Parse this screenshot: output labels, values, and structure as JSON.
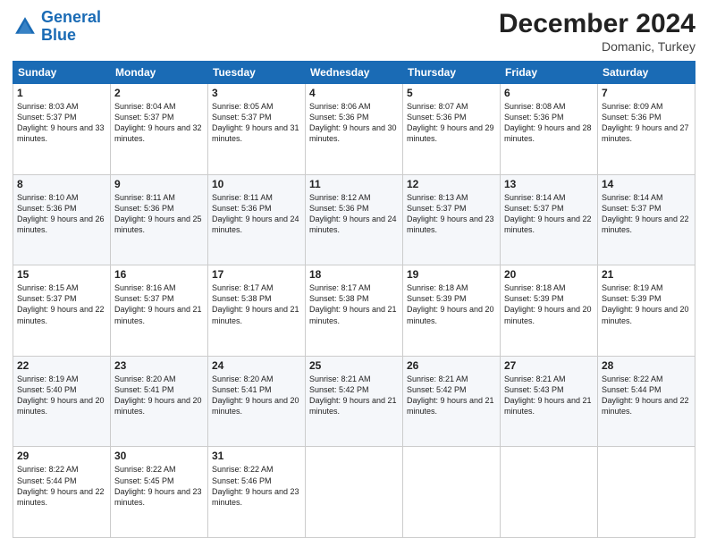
{
  "header": {
    "logo_line1": "General",
    "logo_line2": "Blue",
    "month_title": "December 2024",
    "location": "Domanic, Turkey"
  },
  "days_of_week": [
    "Sunday",
    "Monday",
    "Tuesday",
    "Wednesday",
    "Thursday",
    "Friday",
    "Saturday"
  ],
  "weeks": [
    [
      {
        "day": "1",
        "sunrise": "8:03 AM",
        "sunset": "5:37 PM",
        "daylight": "9 hours and 33 minutes."
      },
      {
        "day": "2",
        "sunrise": "8:04 AM",
        "sunset": "5:37 PM",
        "daylight": "9 hours and 32 minutes."
      },
      {
        "day": "3",
        "sunrise": "8:05 AM",
        "sunset": "5:37 PM",
        "daylight": "9 hours and 31 minutes."
      },
      {
        "day": "4",
        "sunrise": "8:06 AM",
        "sunset": "5:36 PM",
        "daylight": "9 hours and 30 minutes."
      },
      {
        "day": "5",
        "sunrise": "8:07 AM",
        "sunset": "5:36 PM",
        "daylight": "9 hours and 29 minutes."
      },
      {
        "day": "6",
        "sunrise": "8:08 AM",
        "sunset": "5:36 PM",
        "daylight": "9 hours and 28 minutes."
      },
      {
        "day": "7",
        "sunrise": "8:09 AM",
        "sunset": "5:36 PM",
        "daylight": "9 hours and 27 minutes."
      }
    ],
    [
      {
        "day": "8",
        "sunrise": "8:10 AM",
        "sunset": "5:36 PM",
        "daylight": "9 hours and 26 minutes."
      },
      {
        "day": "9",
        "sunrise": "8:11 AM",
        "sunset": "5:36 PM",
        "daylight": "9 hours and 25 minutes."
      },
      {
        "day": "10",
        "sunrise": "8:11 AM",
        "sunset": "5:36 PM",
        "daylight": "9 hours and 24 minutes."
      },
      {
        "day": "11",
        "sunrise": "8:12 AM",
        "sunset": "5:36 PM",
        "daylight": "9 hours and 24 minutes."
      },
      {
        "day": "12",
        "sunrise": "8:13 AM",
        "sunset": "5:37 PM",
        "daylight": "9 hours and 23 minutes."
      },
      {
        "day": "13",
        "sunrise": "8:14 AM",
        "sunset": "5:37 PM",
        "daylight": "9 hours and 22 minutes."
      },
      {
        "day": "14",
        "sunrise": "8:14 AM",
        "sunset": "5:37 PM",
        "daylight": "9 hours and 22 minutes."
      }
    ],
    [
      {
        "day": "15",
        "sunrise": "8:15 AM",
        "sunset": "5:37 PM",
        "daylight": "9 hours and 22 minutes."
      },
      {
        "day": "16",
        "sunrise": "8:16 AM",
        "sunset": "5:37 PM",
        "daylight": "9 hours and 21 minutes."
      },
      {
        "day": "17",
        "sunrise": "8:17 AM",
        "sunset": "5:38 PM",
        "daylight": "9 hours and 21 minutes."
      },
      {
        "day": "18",
        "sunrise": "8:17 AM",
        "sunset": "5:38 PM",
        "daylight": "9 hours and 21 minutes."
      },
      {
        "day": "19",
        "sunrise": "8:18 AM",
        "sunset": "5:39 PM",
        "daylight": "9 hours and 20 minutes."
      },
      {
        "day": "20",
        "sunrise": "8:18 AM",
        "sunset": "5:39 PM",
        "daylight": "9 hours and 20 minutes."
      },
      {
        "day": "21",
        "sunrise": "8:19 AM",
        "sunset": "5:39 PM",
        "daylight": "9 hours and 20 minutes."
      }
    ],
    [
      {
        "day": "22",
        "sunrise": "8:19 AM",
        "sunset": "5:40 PM",
        "daylight": "9 hours and 20 minutes."
      },
      {
        "day": "23",
        "sunrise": "8:20 AM",
        "sunset": "5:41 PM",
        "daylight": "9 hours and 20 minutes."
      },
      {
        "day": "24",
        "sunrise": "8:20 AM",
        "sunset": "5:41 PM",
        "daylight": "9 hours and 20 minutes."
      },
      {
        "day": "25",
        "sunrise": "8:21 AM",
        "sunset": "5:42 PM",
        "daylight": "9 hours and 21 minutes."
      },
      {
        "day": "26",
        "sunrise": "8:21 AM",
        "sunset": "5:42 PM",
        "daylight": "9 hours and 21 minutes."
      },
      {
        "day": "27",
        "sunrise": "8:21 AM",
        "sunset": "5:43 PM",
        "daylight": "9 hours and 21 minutes."
      },
      {
        "day": "28",
        "sunrise": "8:22 AM",
        "sunset": "5:44 PM",
        "daylight": "9 hours and 22 minutes."
      }
    ],
    [
      {
        "day": "29",
        "sunrise": "8:22 AM",
        "sunset": "5:44 PM",
        "daylight": "9 hours and 22 minutes."
      },
      {
        "day": "30",
        "sunrise": "8:22 AM",
        "sunset": "5:45 PM",
        "daylight": "9 hours and 23 minutes."
      },
      {
        "day": "31",
        "sunrise": "8:22 AM",
        "sunset": "5:46 PM",
        "daylight": "9 hours and 23 minutes."
      },
      null,
      null,
      null,
      null
    ]
  ]
}
